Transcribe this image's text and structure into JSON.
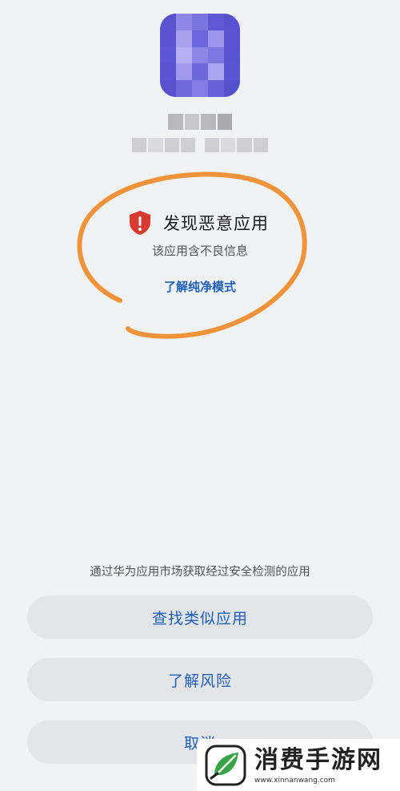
{
  "app": {
    "icon_name": "pixelated-app-icon",
    "name_obscured": true
  },
  "warning": {
    "icon": "shield-exclamation-icon",
    "icon_color": "#d93a2f",
    "title": "发现恶意应用",
    "description": "该应用含不良信息",
    "link_label": "了解纯净模式"
  },
  "annotation": {
    "icon": "hand-drawn-circle",
    "color": "#f0933a"
  },
  "footer": {
    "hint": "通过华为应用市场获取经过安全检测的应用"
  },
  "buttons": {
    "find_similar": "查找类似应用",
    "learn_risk": "了解风险",
    "cancel": "取消"
  },
  "watermark": {
    "logo_icon": "leaf-checkmark-icon",
    "title": "消费手游网",
    "url": "www.xinnanwang.com"
  },
  "colors": {
    "accent": "#1f5fb8",
    "background": "#f1f2f4",
    "button_bg": "#e4e5e8"
  }
}
